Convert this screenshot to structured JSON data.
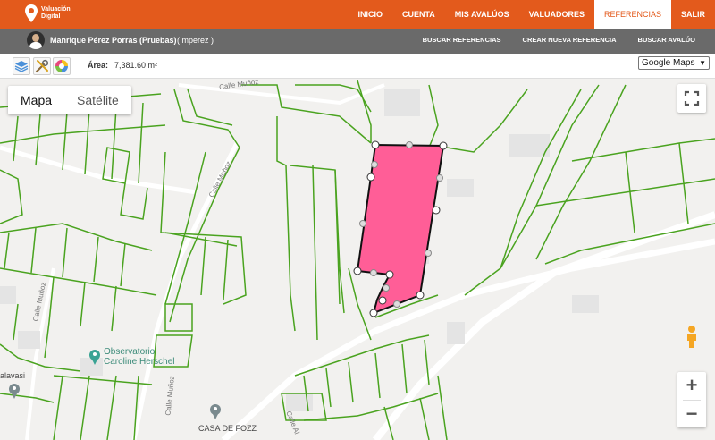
{
  "header": {
    "logo_line1": "Valuación",
    "logo_line2": "Digital",
    "nav": [
      {
        "label": "INICIO",
        "active": false
      },
      {
        "label": "CUENTA",
        "active": false
      },
      {
        "label": "MIS AVALÚOS",
        "active": false
      },
      {
        "label": "VALUADORES",
        "active": false
      },
      {
        "label": "REFERENCIAS",
        "active": true
      },
      {
        "label": "SALIR",
        "active": false
      }
    ]
  },
  "user": {
    "name": "Manrique Pérez Porras (Pruebas)",
    "login": "( mperez )",
    "links": [
      "BUSCAR REFERENCIAS",
      "CREAR NUEVA REFERENCIA",
      "BUSCAR AVALÚO"
    ]
  },
  "toolbar": {
    "area_label": "Área:",
    "area_value": "7,381.60 m²",
    "map_type": "Google Maps"
  },
  "map": {
    "type_buttons": [
      {
        "label": "Mapa",
        "active": true
      },
      {
        "label": "Satélite",
        "active": false
      }
    ],
    "zoom_in": "+",
    "zoom_out": "−",
    "poi": [
      {
        "line1": "Observatorio",
        "line2": "Caroline Herschel"
      },
      {
        "line1": "CASA DE FOZZ"
      },
      {
        "line1": "alavasi"
      }
    ],
    "streets": [
      "Calle Muñoz",
      "Calle Muñoz",
      "Calle Muñoz",
      "Calle Muñoz",
      "Calle Al"
    ],
    "colors": {
      "parcel_line": "#4aa31f",
      "polygon_fill": "#ff5e97",
      "road": "#ffffff",
      "background": "#f2f1ef",
      "accent": "#e35a1c"
    }
  }
}
